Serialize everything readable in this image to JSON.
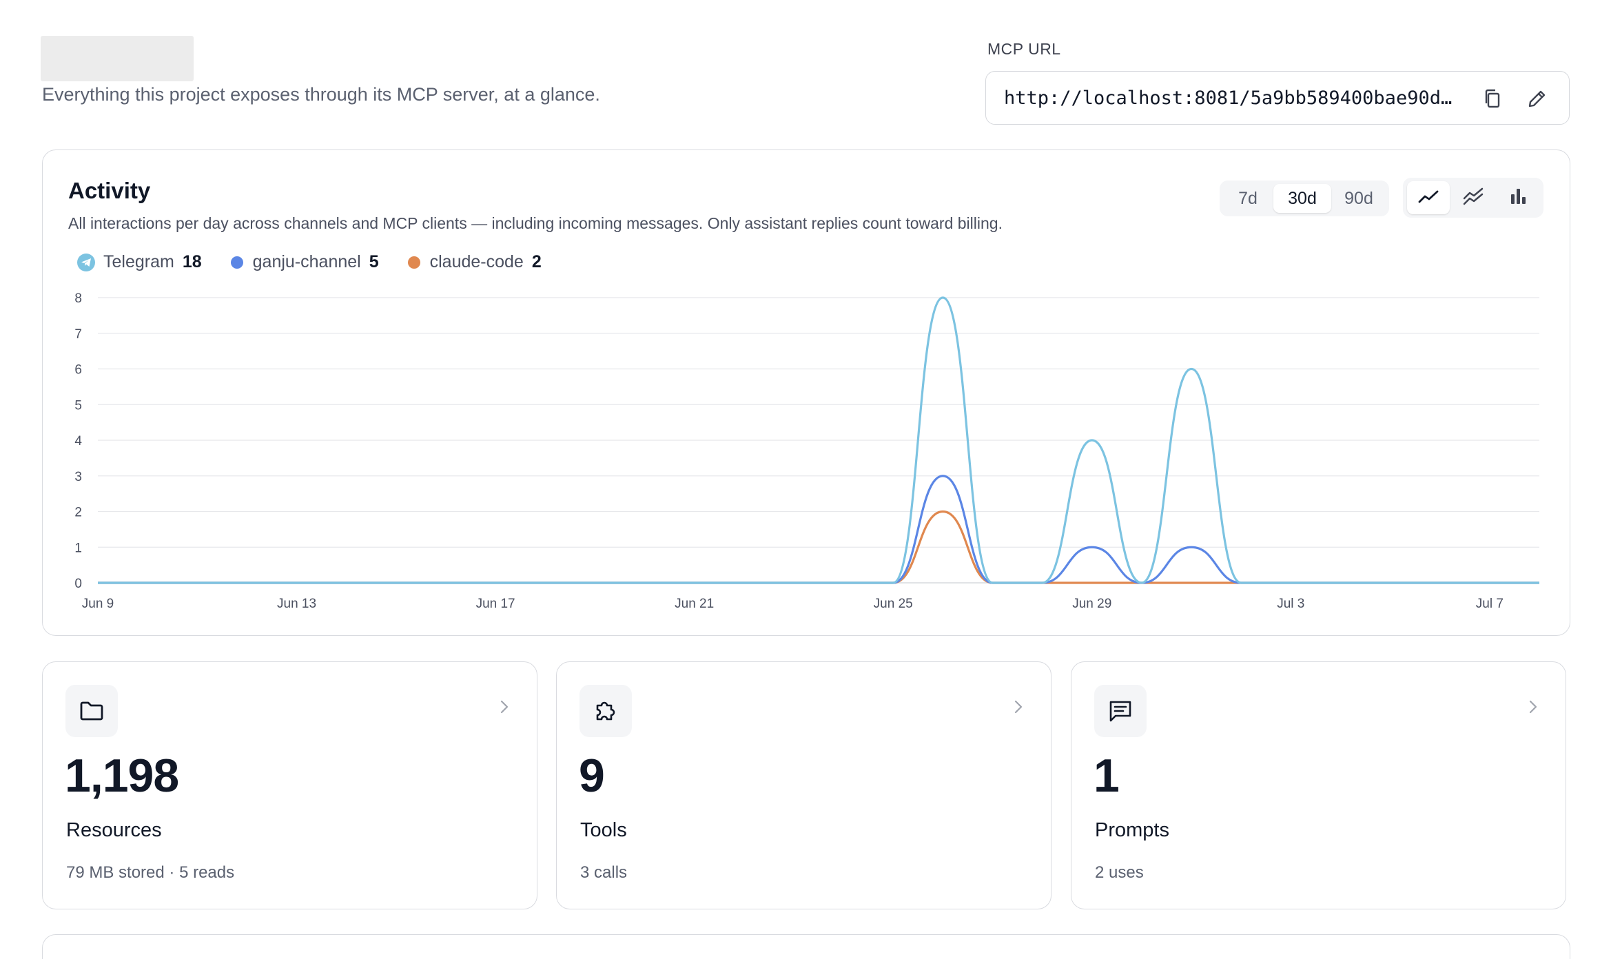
{
  "header": {
    "subtitle": "Everything this project exposes through its MCP server, at a glance."
  },
  "mcp": {
    "label": "MCP URL",
    "url": "http://localhost:8081/5a9bb589400bae90d…"
  },
  "activity": {
    "title": "Activity",
    "description": "All interactions per day across channels and MCP clients — including incoming messages. Only assistant replies count toward billing.",
    "ranges": [
      "7d",
      "30d",
      "90d"
    ],
    "selected_range": "30d",
    "chart_types": [
      "line",
      "stacked-area",
      "bar"
    ],
    "selected_chart_type": "line",
    "legend": [
      {
        "name": "Telegram",
        "count": "18",
        "color": "#7cc3e1",
        "icon": "telegram-icon"
      },
      {
        "name": "ganju-channel",
        "count": "5",
        "color": "#5b86e5"
      },
      {
        "name": "claude-code",
        "count": "2",
        "color": "#e0884f"
      }
    ]
  },
  "chart_data": {
    "type": "line",
    "x": [
      "Jun 9",
      "Jun 10",
      "Jun 11",
      "Jun 12",
      "Jun 13",
      "Jun 14",
      "Jun 15",
      "Jun 16",
      "Jun 17",
      "Jun 18",
      "Jun 19",
      "Jun 20",
      "Jun 21",
      "Jun 22",
      "Jun 23",
      "Jun 24",
      "Jun 25",
      "Jun 26",
      "Jun 27",
      "Jun 28",
      "Jun 29",
      "Jun 30",
      "Jul 1",
      "Jul 2",
      "Jul 3",
      "Jul 4",
      "Jul 5",
      "Jul 6",
      "Jul 7",
      "Jul 8"
    ],
    "x_ticks": [
      "Jun 9",
      "Jun 13",
      "Jun 17",
      "Jun 21",
      "Jun 25",
      "Jun 29",
      "Jul 3",
      "Jul 7"
    ],
    "series": [
      {
        "name": "Telegram",
        "color": "#7cc3e1",
        "values": [
          0,
          0,
          0,
          0,
          0,
          0,
          0,
          0,
          0,
          0,
          0,
          0,
          0,
          0,
          0,
          0,
          0,
          8,
          0,
          0,
          4,
          0,
          6,
          0,
          0,
          0,
          0,
          0,
          0,
          0
        ]
      },
      {
        "name": "ganju-channel",
        "color": "#5b86e5",
        "values": [
          0,
          0,
          0,
          0,
          0,
          0,
          0,
          0,
          0,
          0,
          0,
          0,
          0,
          0,
          0,
          0,
          0,
          3,
          0,
          0,
          1,
          0,
          1,
          0,
          0,
          0,
          0,
          0,
          0,
          0
        ]
      },
      {
        "name": "claude-code",
        "color": "#e0884f",
        "values": [
          0,
          0,
          0,
          0,
          0,
          0,
          0,
          0,
          0,
          0,
          0,
          0,
          0,
          0,
          0,
          0,
          0,
          2,
          0,
          0,
          0,
          0,
          0,
          0,
          0,
          0,
          0,
          0,
          0,
          0
        ]
      }
    ],
    "ylim": [
      0,
      8
    ],
    "yticks": [
      0,
      1,
      2,
      3,
      4,
      5,
      6,
      7,
      8
    ],
    "grid": true,
    "legend": "top-left"
  },
  "stats": [
    {
      "value": "1,198",
      "label": "Resources",
      "sub": "79 MB stored · 5 reads",
      "icon": "folder-icon"
    },
    {
      "value": "9",
      "label": "Tools",
      "sub": "3 calls",
      "icon": "puzzle-icon"
    },
    {
      "value": "1",
      "label": "Prompts",
      "sub": "2 uses",
      "icon": "message-icon"
    }
  ]
}
